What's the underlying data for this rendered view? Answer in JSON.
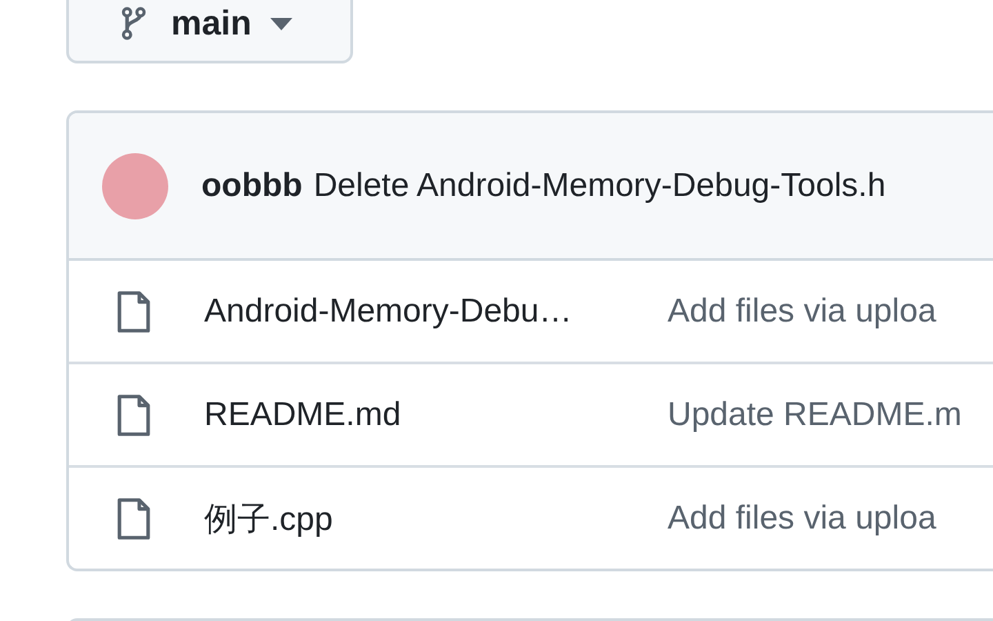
{
  "branch": {
    "name": "main"
  },
  "commit": {
    "author": "oobbb",
    "message": "Delete Android-Memory-Debug-Tools.h"
  },
  "files": [
    {
      "name": "Android-Memory-Debu…",
      "message": "Add files via uploa"
    },
    {
      "name": "README.md",
      "message": "Update README.m"
    },
    {
      "name": "例子.cpp",
      "message": "Add files via uploa"
    }
  ]
}
